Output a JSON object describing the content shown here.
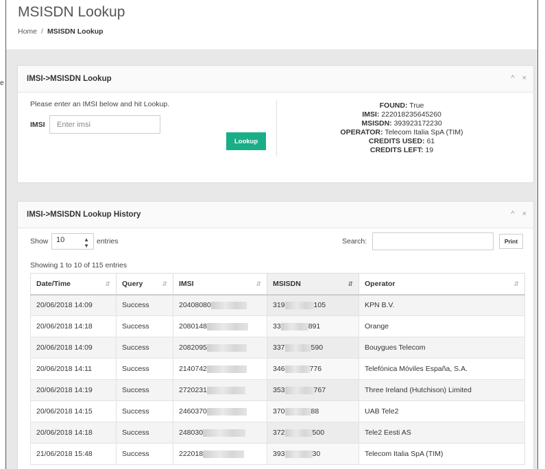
{
  "page": {
    "title": "MSISDN Lookup",
    "breadcrumb": {
      "home": "Home",
      "separator": "/",
      "current": "MSISDN Lookup"
    }
  },
  "lookup_panel": {
    "title": "IMSI->MSISDN Lookup",
    "tools": {
      "collapse": "^",
      "close": "×"
    },
    "instruction": "Please enter an IMSI below and hit Lookup.",
    "imsi_label": "IMSI",
    "imsi_placeholder": "Enter imsi",
    "imsi_value": "",
    "lookup_button": "Lookup",
    "result": {
      "found_label": "FOUND:",
      "found_value": "True",
      "imsi_label": "IMSI:",
      "imsi_value": "222018235645260",
      "msisdn_label": "MSISDN:",
      "msisdn_value": "393923172230",
      "operator_label": "OPERATOR:",
      "operator_value": "Telecom Italia SpA (TIM)",
      "credits_used_label": "CREDITS USED:",
      "credits_used_value": "61",
      "credits_left_label": "CREDITS LEFT:",
      "credits_left_value": "19"
    }
  },
  "history_panel": {
    "title": "IMSI->MSISDN Lookup History",
    "tools": {
      "collapse": "^",
      "close": "×"
    },
    "show_label": "Show",
    "entries_label": "entries",
    "page_length": "10",
    "search_label": "Search:",
    "search_value": "",
    "print_button": "Print",
    "info": "Showing 1 to 10 of 115 entries",
    "columns": [
      "Date/Time",
      "Query",
      "IMSI",
      "MSISDN",
      "Operator"
    ],
    "rows": [
      {
        "datetime": "20/06/2018 14:09",
        "query": "Success",
        "imsi": "20408080",
        "msisdn_pre": "319",
        "msisdn_post": "105",
        "operator": "KPN B.V."
      },
      {
        "datetime": "20/06/2018 14:18",
        "query": "Success",
        "imsi": "2080148",
        "msisdn_pre": "33",
        "msisdn_post": "891",
        "operator": "Orange"
      },
      {
        "datetime": "20/06/2018 14:09",
        "query": "Success",
        "imsi": "2082095",
        "msisdn_pre": "337",
        "msisdn_post": "590",
        "operator": "Bouygues Telecom"
      },
      {
        "datetime": "20/06/2018 14:11",
        "query": "Success",
        "imsi": "2140742",
        "msisdn_pre": "346",
        "msisdn_post": "776",
        "operator": "Telefónica Móviles España, S.A."
      },
      {
        "datetime": "20/06/2018 14:19",
        "query": "Success",
        "imsi": "2720231",
        "msisdn_pre": "353",
        "msisdn_post": "767",
        "operator": "Three Ireland (Hutchison) Limited"
      },
      {
        "datetime": "20/06/2018 14:15",
        "query": "Success",
        "imsi": "2460370",
        "msisdn_pre": "370",
        "msisdn_post": "88",
        "operator": "UAB Tele2"
      },
      {
        "datetime": "20/06/2018 14:18",
        "query": "Success",
        "imsi": "248030",
        "msisdn_pre": "372",
        "msisdn_post": "500",
        "operator": "Tele2 Eesti AS"
      },
      {
        "datetime": "21/06/2018 15:48",
        "query": "Success",
        "imsi": "222018",
        "msisdn_pre": "393",
        "msisdn_post": "30",
        "operator": "Telecom Italia SpA (TIM)"
      }
    ]
  },
  "side_label": "e",
  "colors": {
    "accent": "#1aae88",
    "background": "#e8e8e8"
  }
}
